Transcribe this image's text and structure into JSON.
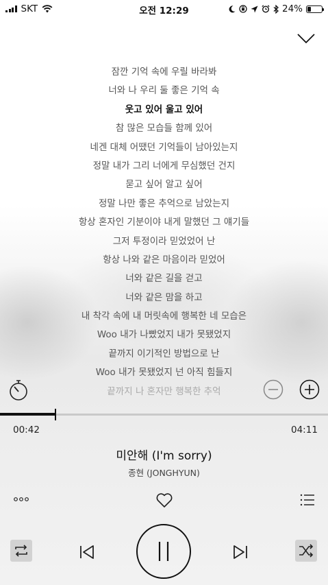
{
  "status_bar": {
    "carrier": "SKT",
    "time": "오전 12:29",
    "battery": "24%",
    "battery_level": 0.24,
    "icons": [
      "signal-icon",
      "wifi-icon",
      "moon-icon",
      "rotation-lock-icon",
      "location-icon",
      "alarm-icon",
      "bluetooth-icon",
      "battery-icon"
    ]
  },
  "lyrics": {
    "lines": [
      "잠깐 기억 속에 우릴 바라봐",
      "너와 나 우리 둘 좋은 기억 속",
      "웃고 있어 울고 있어",
      "참 많은 모습들 함께 있어",
      "네겐 대체 어땠던 기억들이 남아있는지",
      "정말 내가 그리 너에게 무심했던 건지",
      "묻고 싶어 알고 싶어",
      "정말 나만 좋은 추억으로 남았는지",
      "항상 혼자인 기분이야 내게 말했던 그 얘기들",
      "그저 투정이라 믿었었어 난",
      "항상 나와 같은 마음이라 믿었어",
      "너와 같은 길을 걷고",
      "너와 같은 맘을 하고",
      "내 착각 속에 내 머릿속에 행복한 네 모습은",
      "Woo 내가 나빴었지 내가 못됐었지",
      "끝까지 이기적인 방법으로 난",
      "Woo 내가 못됐었지 넌 아직 힘들지",
      "끝까지 나 혼자만 행복한 추억"
    ],
    "current_index": 2
  },
  "player": {
    "elapsed": "00:42",
    "total": "04:11",
    "progress": 0.167,
    "title": "미안해 (I'm sorry)",
    "artist": "종현 (JONGHYUN)"
  },
  "colors": {
    "text_primary": "#111111",
    "toggle_active_bg": "#d2d2d2",
    "track": "#c9c9c9"
  }
}
